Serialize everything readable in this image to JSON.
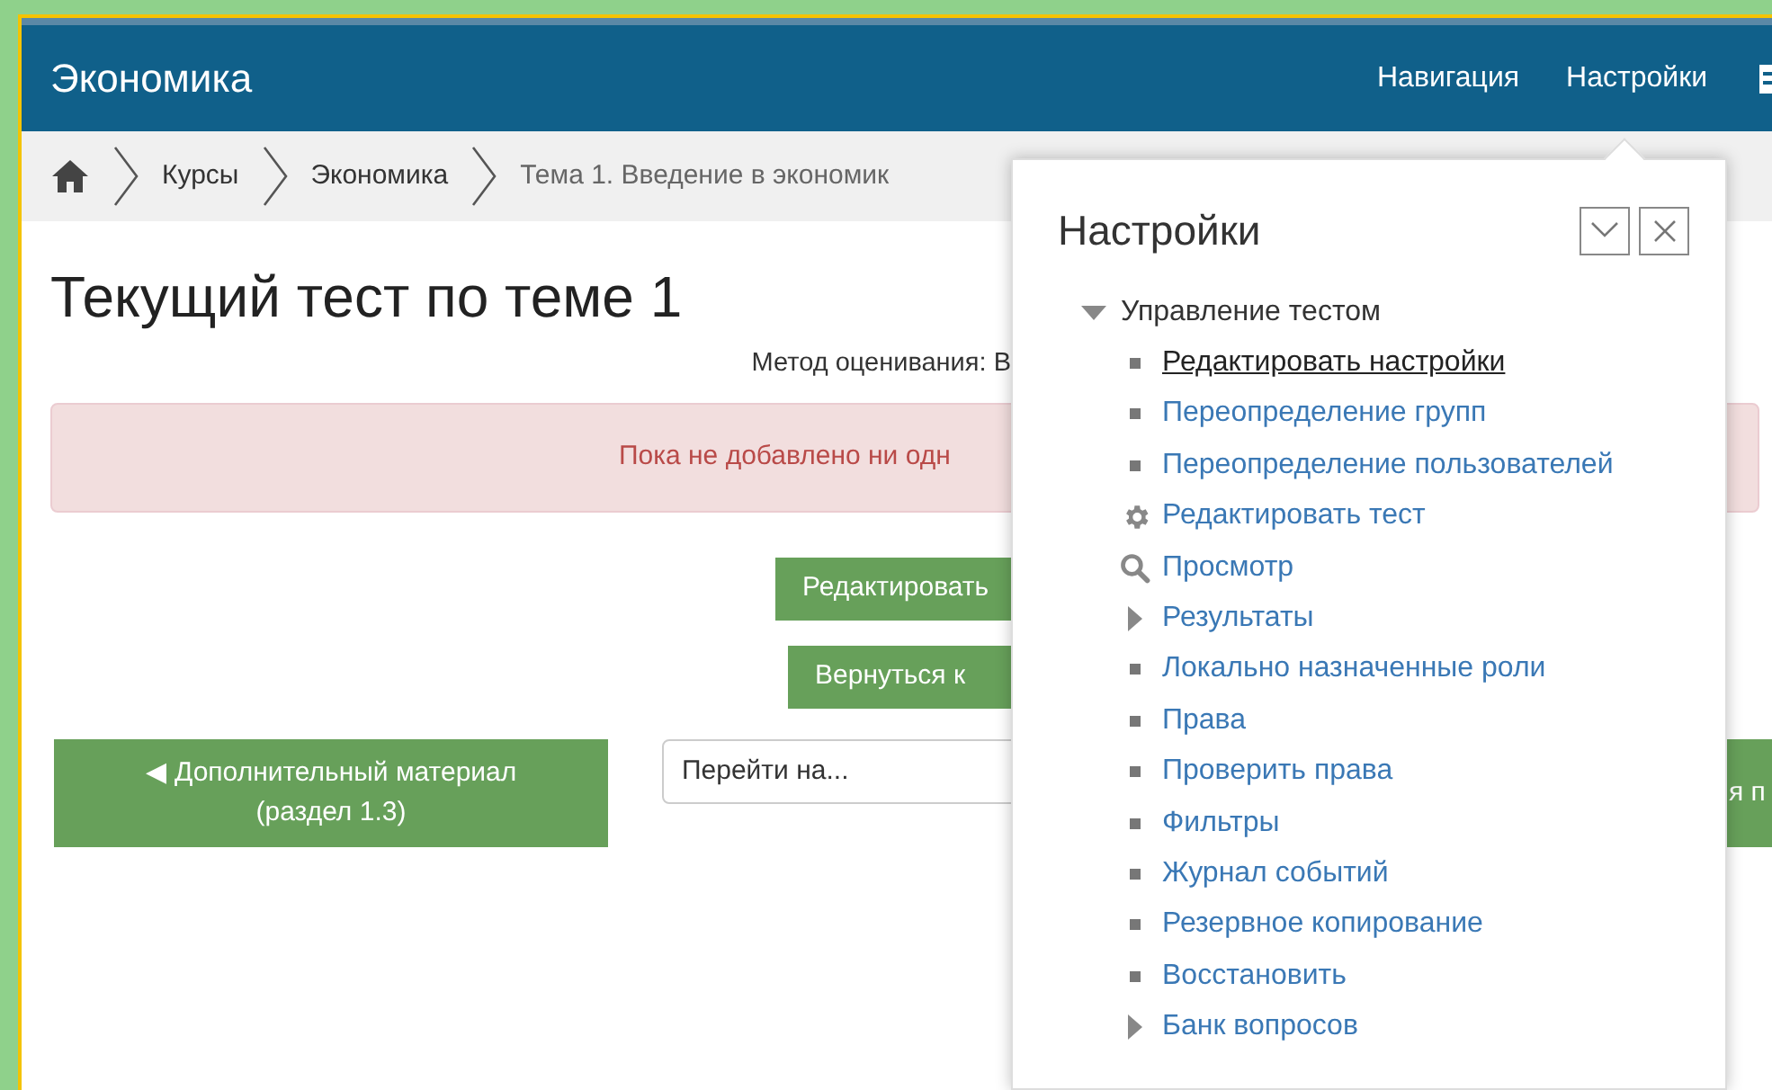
{
  "header": {
    "site_title": "Экономика",
    "nav": [
      "Навигация",
      "Настройки"
    ]
  },
  "breadcrumb": [
    "Курсы",
    "Экономика",
    "Тема 1. Введение в экономик"
  ],
  "page": {
    "title": "Текущий тест по теме 1",
    "grading_method": "Метод оценивания: В",
    "alert": "Пока не добавлено ни одн",
    "buttons": [
      "Редактировать",
      "Вернуться к"
    ],
    "prev_button": {
      "arrow": "◀",
      "lines": [
        "Дополнительный материал",
        "(раздел 1.3)"
      ]
    },
    "jump_select": {
      "value": "Перейти на..."
    },
    "next_button": {
      "text": "я п"
    }
  },
  "settings_popup": {
    "title": "Настройки",
    "tree": [
      {
        "label": "Управление тестом",
        "kind": "branch",
        "expanded": true,
        "children": [
          {
            "label": "Редактировать настройки",
            "kind": "leaf",
            "hovered": true
          },
          {
            "label": "Переопределение групп",
            "kind": "leaf",
            "hovered": false
          },
          {
            "label": "Переопределение пользователей",
            "kind": "leaf",
            "hovered": false
          },
          {
            "label": "Редактировать тест",
            "kind": "gear",
            "hovered": false
          },
          {
            "label": "Просмотр",
            "kind": "search",
            "hovered": false
          },
          {
            "label": "Результаты",
            "kind": "branch",
            "expanded": false,
            "hovered": false
          },
          {
            "label": "Локально назначенные роли",
            "kind": "leaf",
            "hovered": false
          },
          {
            "label": "Права",
            "kind": "leaf",
            "hovered": false
          },
          {
            "label": "Проверить права",
            "kind": "leaf",
            "hovered": false
          },
          {
            "label": "Фильтры",
            "kind": "leaf",
            "hovered": false
          },
          {
            "label": "Журнал событий",
            "kind": "leaf",
            "hovered": false
          },
          {
            "label": "Резервное копирование",
            "kind": "leaf",
            "hovered": false
          },
          {
            "label": "Восстановить",
            "kind": "leaf",
            "hovered": false
          },
          {
            "label": "Банк вопросов",
            "kind": "branch",
            "expanded": false,
            "hovered": false
          }
        ]
      }
    ]
  }
}
